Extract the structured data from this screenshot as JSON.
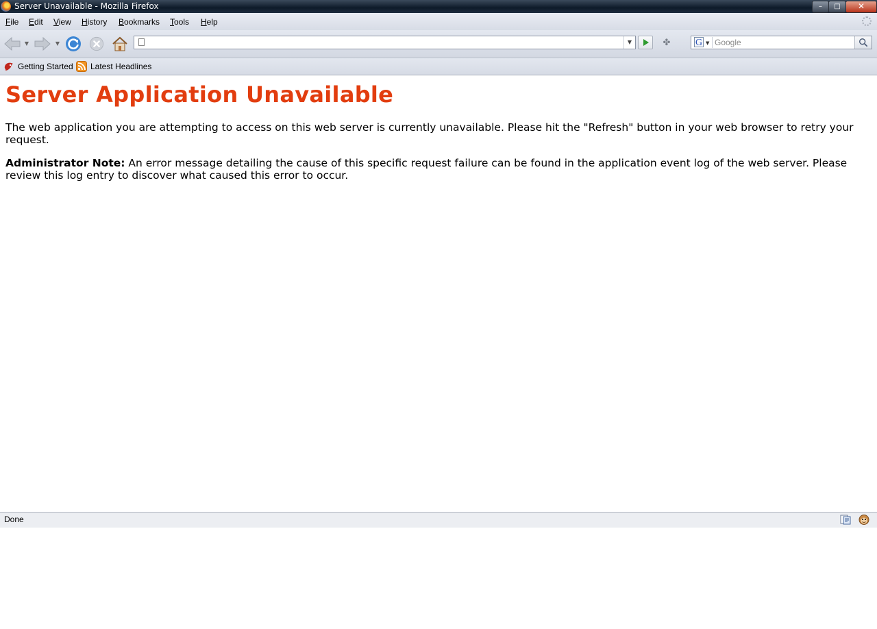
{
  "window": {
    "title": "Server Unavailable - Mozilla Firefox",
    "minimize_label": "–",
    "maximize_label": "□",
    "close_label": "✕"
  },
  "menu": [
    "File",
    "Edit",
    "View",
    "History",
    "Bookmarks",
    "Tools",
    "Help"
  ],
  "navigation": {
    "url_value": "",
    "search_engine": "G",
    "search_placeholder": "Google"
  },
  "bookmarks": [
    {
      "label": "Getting Started",
      "icon": "getting-started-icon"
    },
    {
      "label": "Latest Headlines",
      "icon": "rss-feed-icon"
    }
  ],
  "page": {
    "heading": "Server Application Unavailable",
    "paragraph1": "The web application you are attempting to access on this web server is currently unavailable.  Please hit the \"Refresh\" button in your web browser to retry your request.",
    "note_label": "Administrator Note:",
    "note_text": " An error message detailing the cause of this specific request failure can be found in the application event log of the web server.  Please review this log entry to discover what caused this error to occur."
  },
  "status": {
    "text": "Done"
  },
  "colors": {
    "heading": "#e23d0f",
    "titlebar": "#0d1a29"
  }
}
